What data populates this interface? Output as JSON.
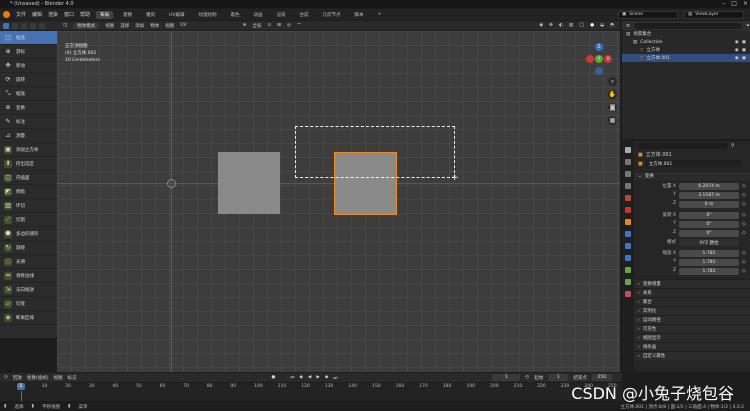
{
  "window": {
    "title": "* (Unsaved) - Blender 4.0"
  },
  "menubar": {
    "menus": [
      "文件",
      "编辑",
      "渲染",
      "窗口",
      "帮助"
    ],
    "workspaces": [
      "布局",
      "建模",
      "雕刻",
      "UV编辑",
      "纹理绘制",
      "着色",
      "动画",
      "渲染",
      "合成",
      "几何节点",
      "脚本"
    ],
    "active_workspace": "布局",
    "scene": "Scene",
    "view_layer": "ViewLayer"
  },
  "header": {
    "mode": "物体模式",
    "menus": [
      "视图",
      "选择",
      "添加",
      "物体",
      "视图",
      "UV"
    ],
    "transform_orientation": "全局"
  },
  "tools": [
    {
      "icon": "select-box-icon",
      "label": "框选",
      "active": true
    },
    {
      "icon": "cursor-icon",
      "label": "游标"
    },
    {
      "icon": "move-icon",
      "label": "移动"
    },
    {
      "icon": "rotate-icon",
      "label": "旋转"
    },
    {
      "icon": "scale-icon",
      "label": "缩放"
    },
    {
      "icon": "transform-icon",
      "label": "变换"
    },
    {
      "icon": "annotate-icon",
      "label": "标注"
    },
    {
      "icon": "measure-icon",
      "label": "测量"
    },
    {
      "icon": "add-cube-icon",
      "label": "添加立方体"
    },
    {
      "icon": "extrude-icon",
      "label": "挤出选区"
    },
    {
      "icon": "inset-icon",
      "label": "内插面"
    },
    {
      "icon": "bevel-icon",
      "label": "倒角"
    },
    {
      "icon": "loopcut-icon",
      "label": "环切"
    },
    {
      "icon": "knife-icon",
      "label": "切割"
    },
    {
      "icon": "polybuild-icon",
      "label": "多边形建形"
    },
    {
      "icon": "spin-icon",
      "label": "旋绕"
    },
    {
      "icon": "smooth-icon",
      "label": "光滑"
    },
    {
      "icon": "edge-slide-icon",
      "label": "滑移边线"
    },
    {
      "icon": "shrink-icon",
      "label": "法向缩放"
    },
    {
      "icon": "shear-icon",
      "label": "切变"
    },
    {
      "icon": "rip-icon",
      "label": "断离区域"
    }
  ],
  "viewport": {
    "info_lines": [
      "正交顶视图",
      "(0) 立方体.001",
      "10 Centimeters"
    ]
  },
  "outliner": {
    "rows": [
      {
        "label": "场景集合",
        "indent": 0
      },
      {
        "label": "Collection",
        "indent": 1
      },
      {
        "label": "立方体",
        "indent": 2
      },
      {
        "label": "立方体.001",
        "indent": 2,
        "selected": true
      }
    ]
  },
  "properties": {
    "object_name": "立方体.001",
    "data_name": "立方体.001",
    "transform_section": "变换",
    "location": {
      "label": "位置 X",
      "x": "6.2074 m",
      "y": "3.1187 m",
      "z": "0 m"
    },
    "rotation": {
      "label": "旋转 X",
      "x": "0°",
      "y": "0°",
      "z": "0°"
    },
    "mode": {
      "label": "模式",
      "value": "XYZ 欧拉"
    },
    "scale": {
      "label": "缩放 X",
      "x": "1.781",
      "y": "1.781",
      "z": "1.781"
    },
    "axis_y": "Y",
    "axis_z": "Z",
    "sections": [
      "变换增量",
      "关系",
      "集合",
      "实例化",
      "运动路径",
      "可见性",
      "视图显示",
      "线条画",
      "自定义属性"
    ]
  },
  "timeline": {
    "menus": [
      "回放",
      "抠像(插帧)",
      "视图",
      "标记"
    ],
    "current_frame": "1",
    "ticks": [
      "0",
      "10",
      "20",
      "30",
      "40",
      "50",
      "60",
      "70",
      "80",
      "90",
      "100",
      "110",
      "120",
      "130",
      "140",
      "150",
      "160",
      "170",
      "180",
      "190",
      "200",
      "210",
      "220",
      "230",
      "240",
      "250"
    ],
    "start_label": "起始",
    "start": "1",
    "end_label": "结束点",
    "end": "250"
  },
  "statusbar": {
    "items": [
      "选择",
      "平移视图",
      "菜单"
    ],
    "stats": "立方体.001 | 顶点:8/8 | 面:2/2 | 三角面:4 | 物体:1/2 | 4.0.2"
  },
  "watermark": "CSDN @小兔子烧包谷"
}
